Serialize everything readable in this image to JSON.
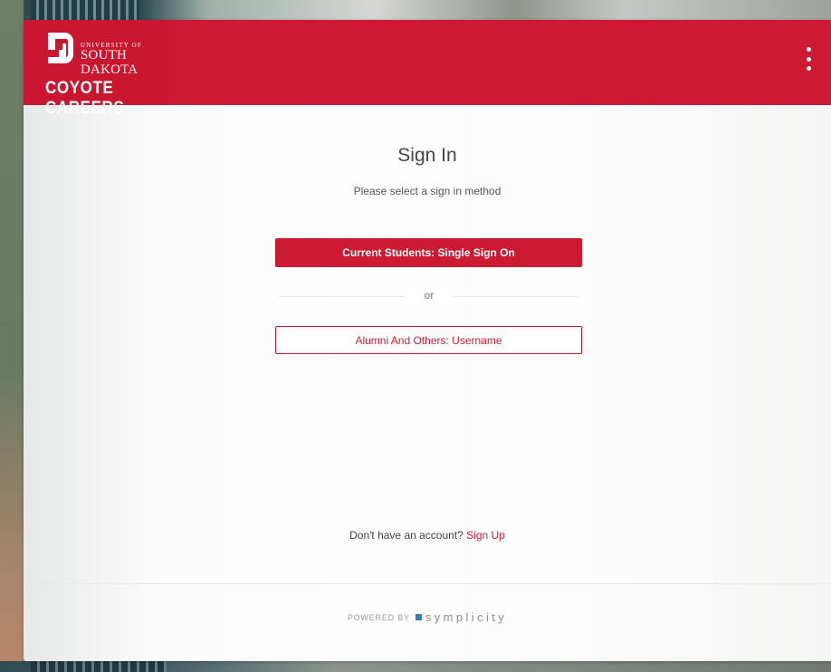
{
  "brand": {
    "university_small": "UNIVERSITY OF",
    "university_name": "SOUTH DAKOTA",
    "app_name": "COYOTE CAREERS",
    "logo_icon": "sd-logo-icon",
    "brand_color": "#cd1a33"
  },
  "header": {
    "menu_icon": "kebab-menu-icon"
  },
  "signin": {
    "title": "Sign In",
    "subtitle": "Please select a sign in method",
    "primary_button": "Current Students: Single Sign On",
    "divider_text": "or",
    "secondary_button": "Alumni And Others: Username"
  },
  "signup": {
    "prompt": "Don't have an account?",
    "link": "Sign Up"
  },
  "footer": {
    "powered_by": "POWERED BY",
    "vendor": "symplicity",
    "vendor_color": "#2a7fc5"
  }
}
